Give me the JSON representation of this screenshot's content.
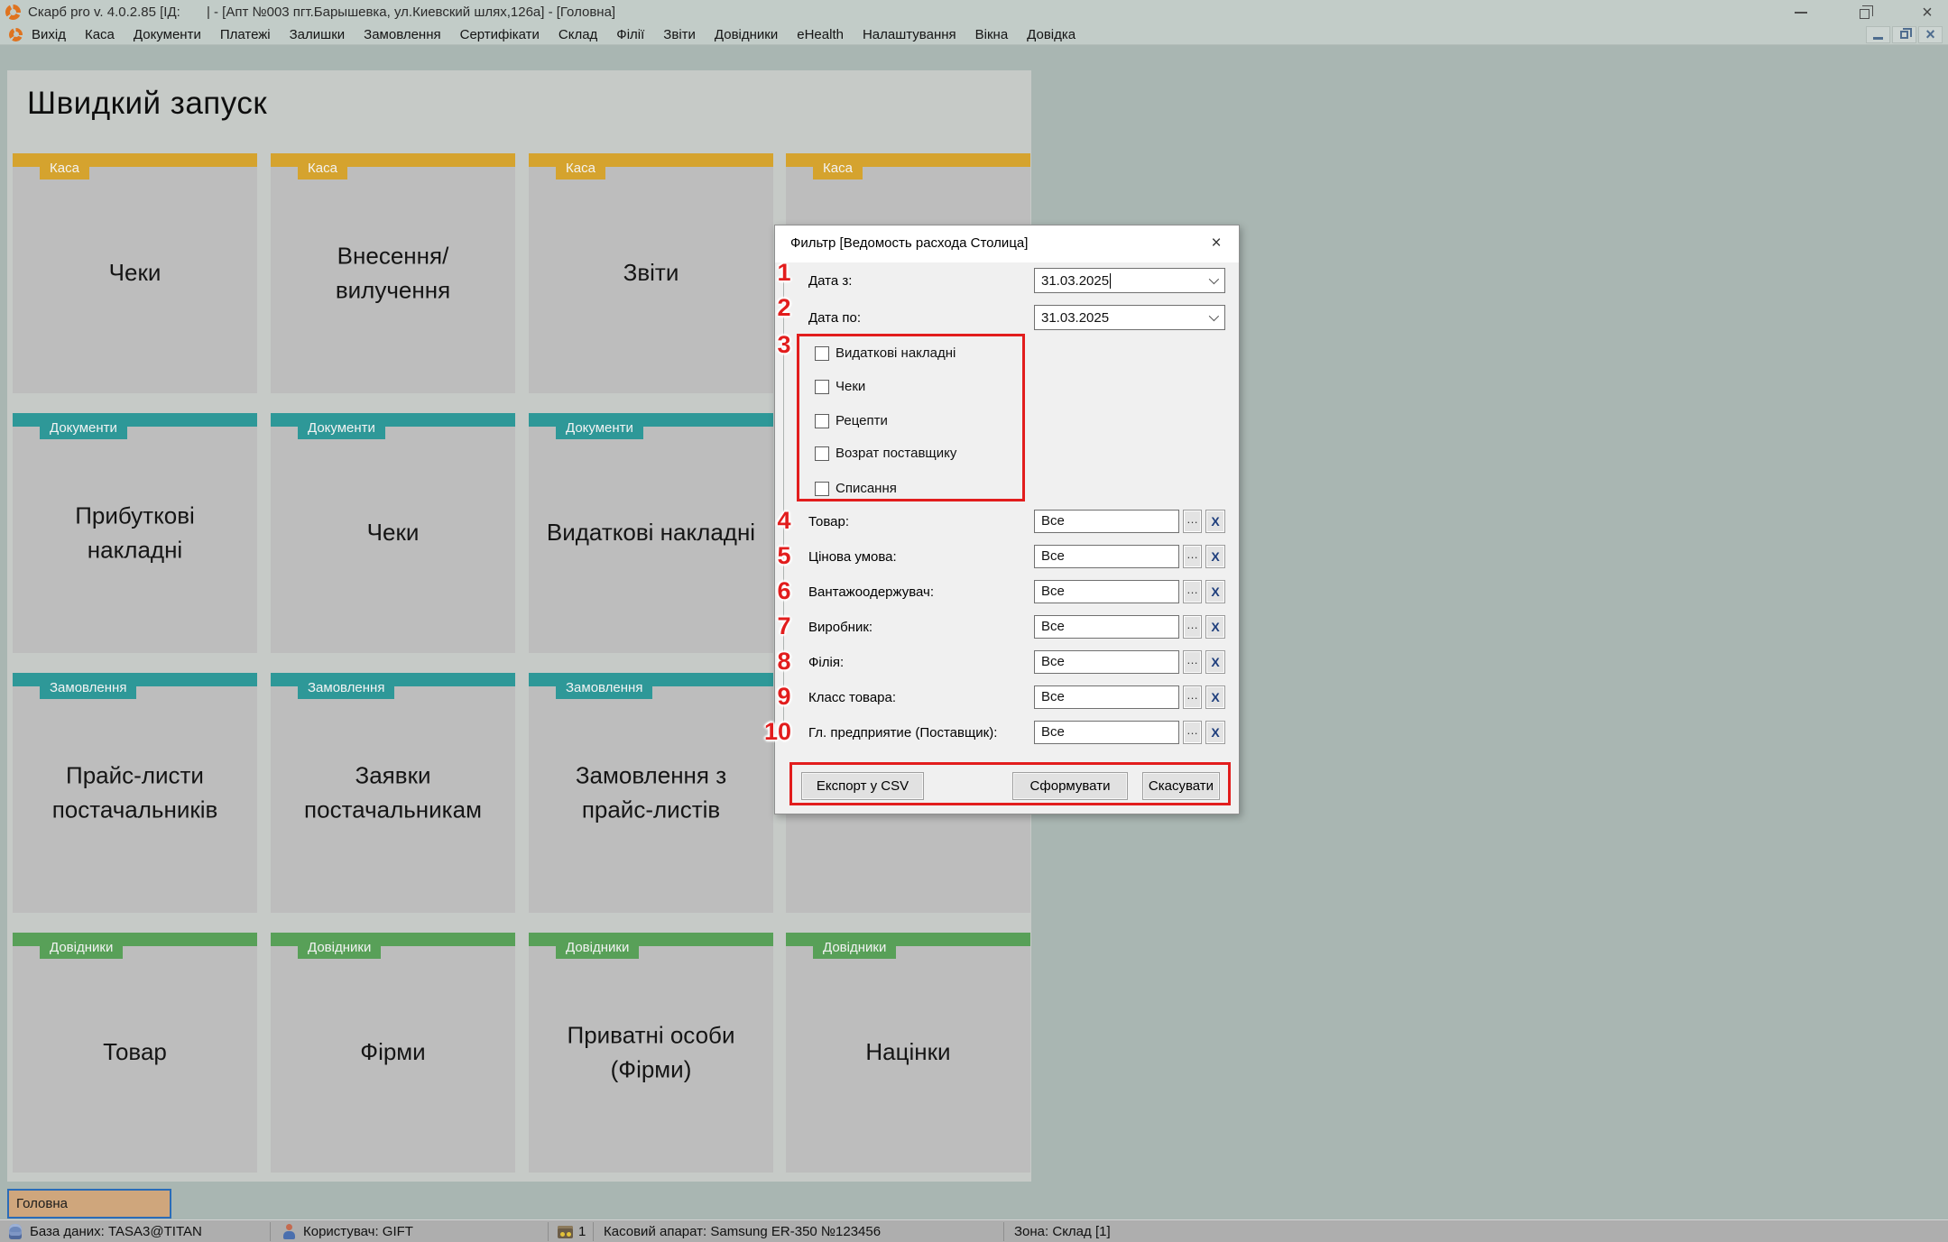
{
  "colors": {
    "kasa_header": "#d5a32e",
    "documents_header": "#2e9898",
    "orders_header": "#2e9898",
    "handbooks_header": "#58a058",
    "annotation_red": "#e21d1d",
    "tab_bg": "#cfa67c",
    "tab_border": "#2a6cb8",
    "background": "#a9b6b2"
  },
  "titlebar": {
    "title": "Скарб pro v. 4.0.2.85 [ІД:       | - [Апт №003 пгт.Барышевка, ул.Киевский шлях,126а] - [Головна]"
  },
  "menu": {
    "items": [
      "Вихід",
      "Каса",
      "Документи",
      "Платежі",
      "Залишки",
      "Замовлення",
      "Сертифікати",
      "Склад",
      "Філії",
      "Звіти",
      "Довідники",
      "eHealth",
      "Налаштування",
      "Вікна",
      "Довідка"
    ]
  },
  "quick_launch": {
    "heading": "Швидкий запуск",
    "tiles": [
      {
        "category": "Каса",
        "label": "Чеки"
      },
      {
        "category": "Каса",
        "label": "Внесення/вилучення"
      },
      {
        "category": "Каса",
        "label": "Звіти"
      },
      {
        "category": "Каса",
        "label": ""
      },
      {
        "category": "Документи",
        "label": "Прибуткові накладні"
      },
      {
        "category": "Документи",
        "label": "Чеки"
      },
      {
        "category": "Документи",
        "label": "Видаткові накладні"
      },
      {
        "category": "",
        "label": ""
      },
      {
        "category": "Замовлення",
        "label": "Прайс-листи постачальників"
      },
      {
        "category": "Замовлення",
        "label": "Заявки постачальникам"
      },
      {
        "category": "Замовлення",
        "label": "Замовлення з прайс-листів"
      },
      {
        "category": "",
        "label": ""
      },
      {
        "category": "Довідники",
        "label": "Товар"
      },
      {
        "category": "Довідники",
        "label": "Фірми"
      },
      {
        "category": "Довідники",
        "label": "Приватні особи (Фірми)"
      },
      {
        "category": "Довідники",
        "label": "Націнки"
      }
    ]
  },
  "dialog": {
    "title": "Фильтр [Ведомость расхода Столица]",
    "date_fields": [
      {
        "num": "1",
        "label": "Дата з:",
        "value": "31.03.2025"
      },
      {
        "num": "2",
        "label": "Дата по:",
        "value": "31.03.2025"
      }
    ],
    "checkbox_group": {
      "num": "3",
      "items": [
        "Видаткові накладні",
        "Чеки",
        "Рецепти",
        "Возрат поставщику",
        "Списання"
      ]
    },
    "lookup_fields": [
      {
        "num": "4",
        "label": "Товар:",
        "value": "Все"
      },
      {
        "num": "5",
        "label": "Цінова умова:",
        "value": "Все"
      },
      {
        "num": "6",
        "label": "Вантажоодержувач:",
        "value": "Все"
      },
      {
        "num": "7",
        "label": "Виробник:",
        "value": "Все"
      },
      {
        "num": "8",
        "label": "Філія:",
        "value": "Все"
      },
      {
        "num": "9",
        "label": "Класс товара:",
        "value": "Все"
      },
      {
        "num": "10",
        "label": "Гл. предприятие (Поставщик):",
        "value": "Все"
      }
    ],
    "buttons": {
      "export": "Експорт у CSV",
      "generate": "Сформувати",
      "cancel": "Скасувати"
    }
  },
  "icons": {
    "close": "×",
    "dots": "…",
    "clear": "X"
  },
  "footer": {
    "tab_label": "Головна",
    "status": {
      "database": "База даних: TASA3@TITAN",
      "user": "Користувач: GIFT",
      "count": "1",
      "cash_register": "Касовий апарат: Samsung ER-350 №123456",
      "zone": "Зона: Склад [1]"
    }
  }
}
